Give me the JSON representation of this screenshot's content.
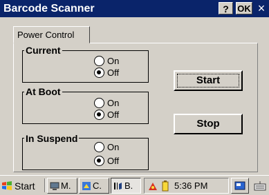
{
  "window": {
    "title": "Barcode Scanner",
    "help_label": "?",
    "ok_label": "OK",
    "close_label": "×"
  },
  "tab": {
    "label": "Power Control"
  },
  "groups": [
    {
      "label": "Current",
      "options": [
        {
          "label": "On",
          "checked": false
        },
        {
          "label": "Off",
          "checked": true
        }
      ]
    },
    {
      "label": "At Boot",
      "options": [
        {
          "label": "On",
          "checked": false
        },
        {
          "label": "Off",
          "checked": true
        }
      ]
    },
    {
      "label": "In Suspend",
      "options": [
        {
          "label": "On",
          "checked": false
        },
        {
          "label": "Off",
          "checked": true
        }
      ]
    }
  ],
  "buttons": {
    "start": "Start",
    "stop": "Stop"
  },
  "taskbar": {
    "start_label": "Start",
    "tasks": [
      {
        "label": "M."
      },
      {
        "label": "C."
      },
      {
        "label": "B."
      }
    ],
    "time": "5:36 PM"
  },
  "colors": {
    "title_bar": "#0a246a",
    "face": "#d4d0c8"
  }
}
